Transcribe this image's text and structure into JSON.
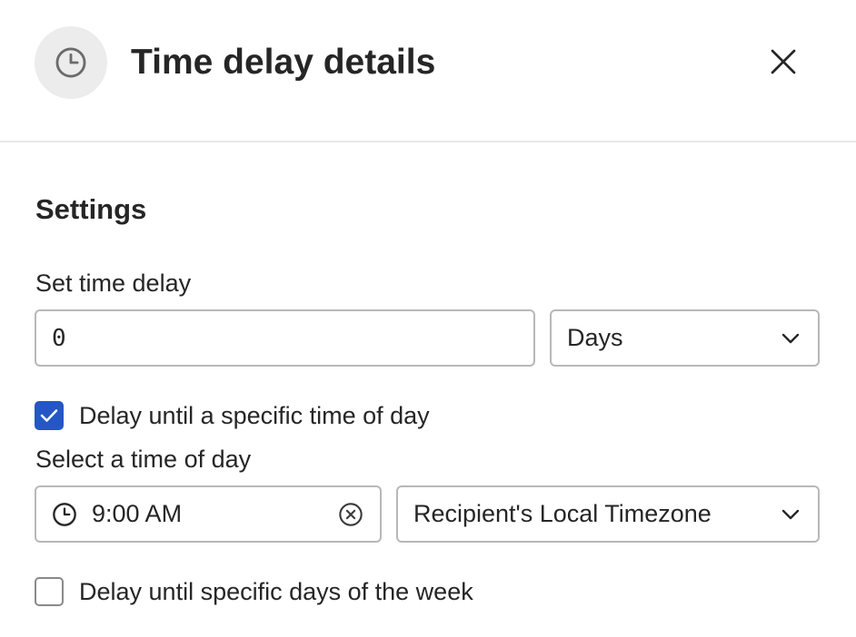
{
  "header": {
    "title": "Time delay details",
    "icon": "clock-icon",
    "close_icon": "close-icon"
  },
  "settings": {
    "section_title": "Settings",
    "time_delay": {
      "label": "Set time delay",
      "value": "0",
      "unit_selected": "Days"
    },
    "specific_time_checkbox": {
      "label": "Delay until a specific time of day",
      "checked": true
    },
    "time_of_day": {
      "label": "Select a time of day",
      "value": "9:00 AM",
      "timezone_selected": "Recipient's Local Timezone"
    },
    "specific_days_checkbox": {
      "label": "Delay until specific days of the week",
      "checked": false
    }
  },
  "colors": {
    "accent": "#2457c5",
    "border": "#b8b8b8",
    "icon_bg": "#ececec",
    "text": "#262626"
  }
}
